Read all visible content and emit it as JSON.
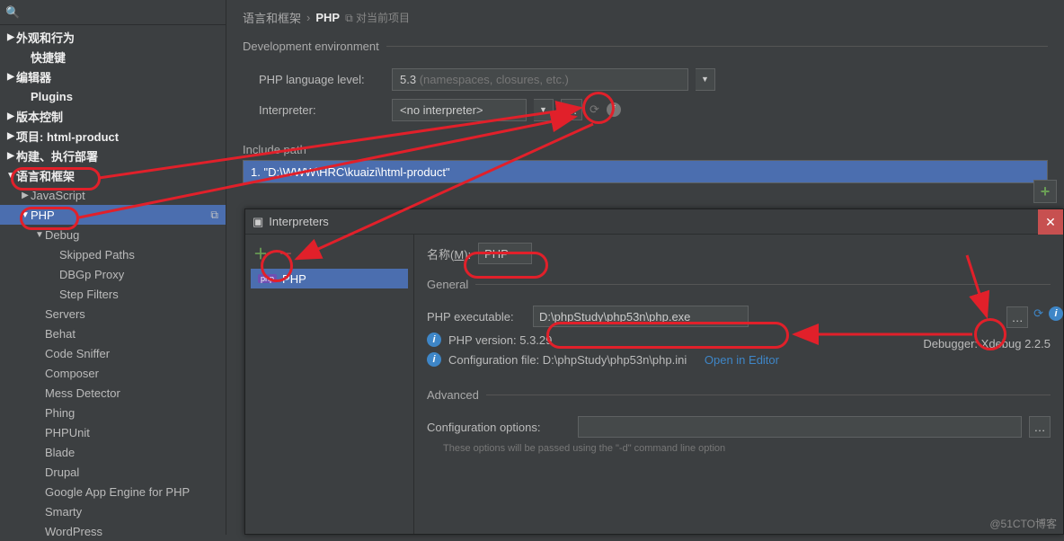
{
  "search": {
    "placeholder": ""
  },
  "sidebar": {
    "items": [
      {
        "label": "外观和行为",
        "caret": "▶",
        "bold": true,
        "lvl": 0
      },
      {
        "label": "快捷键",
        "caret": "",
        "bold": true,
        "lvl": 1
      },
      {
        "label": "编辑器",
        "caret": "▶",
        "bold": true,
        "lvl": 0
      },
      {
        "label": "Plugins",
        "caret": "",
        "bold": true,
        "lvl": 1
      },
      {
        "label": "版本控制",
        "caret": "▶",
        "bold": true,
        "lvl": 0
      },
      {
        "label": "项目: html-product",
        "caret": "▶",
        "bold": true,
        "lvl": 0
      },
      {
        "label": "构建、执行部署",
        "caret": "▶",
        "bold": true,
        "lvl": 0
      },
      {
        "label": "语言和框架",
        "caret": "▼",
        "bold": true,
        "lvl": 0
      },
      {
        "label": "JavaScript",
        "caret": "▶",
        "bold": false,
        "lvl": 1
      },
      {
        "label": "PHP",
        "caret": "▼",
        "bold": false,
        "lvl": 1,
        "sel": true,
        "badge": "⧉"
      },
      {
        "label": "Debug",
        "caret": "▼",
        "bold": false,
        "lvl": 2
      },
      {
        "label": "Skipped Paths",
        "caret": "",
        "bold": false,
        "lvl": 3
      },
      {
        "label": "DBGp Proxy",
        "caret": "",
        "bold": false,
        "lvl": 3
      },
      {
        "label": "Step Filters",
        "caret": "",
        "bold": false,
        "lvl": 3
      },
      {
        "label": "Servers",
        "caret": "",
        "bold": false,
        "lvl": 2
      },
      {
        "label": "Behat",
        "caret": "",
        "bold": false,
        "lvl": 2
      },
      {
        "label": "Code Sniffer",
        "caret": "",
        "bold": false,
        "lvl": 2
      },
      {
        "label": "Composer",
        "caret": "",
        "bold": false,
        "lvl": 2
      },
      {
        "label": "Mess Detector",
        "caret": "",
        "bold": false,
        "lvl": 2
      },
      {
        "label": "Phing",
        "caret": "",
        "bold": false,
        "lvl": 2
      },
      {
        "label": "PHPUnit",
        "caret": "",
        "bold": false,
        "lvl": 2
      },
      {
        "label": "Blade",
        "caret": "",
        "bold": false,
        "lvl": 2
      },
      {
        "label": "Drupal",
        "caret": "",
        "bold": false,
        "lvl": 2
      },
      {
        "label": "Google App Engine for PHP",
        "caret": "",
        "bold": false,
        "lvl": 2
      },
      {
        "label": "Smarty",
        "caret": "",
        "bold": false,
        "lvl": 2
      },
      {
        "label": "WordPress",
        "caret": "",
        "bold": false,
        "lvl": 2
      }
    ]
  },
  "crumb": {
    "cat": "语言和框架",
    "page": "PHP",
    "tag": "⧉ 对当前项目"
  },
  "dev": {
    "legend": "Development environment",
    "lang_label": "PHP language level:",
    "lang_value": "5.3",
    "lang_hint": "(namespaces, closures, etc.)",
    "interp_label": "Interpreter:",
    "interp_value": "<no interpreter>"
  },
  "include": {
    "label": "Include path",
    "row": "1. \"D:\\WWW\\HRC\\kuaizi\\html-product\""
  },
  "dialog": {
    "title": "Interpreters",
    "name_label": "名称(",
    "name_u": "M",
    "name_suffix": "):",
    "name_value": "PHP",
    "list_item": "PHP",
    "general": "General",
    "exe_label": "PHP executable:",
    "exe_value": "D:\\phpStudy\\php53n\\php.exe",
    "version": "PHP version: 5.3.29",
    "debugger": "Debugger: Xdebug 2.2.5",
    "config": "Configuration file: D:\\phpStudy\\php53n\\php.ini",
    "open": "Open in Editor",
    "advanced": "Advanced",
    "cfg_opt_label": "Configuration options:",
    "cfg_hint": "These options will be passed using the \"-d\" command line option"
  },
  "watermark": "@51CTO博客"
}
